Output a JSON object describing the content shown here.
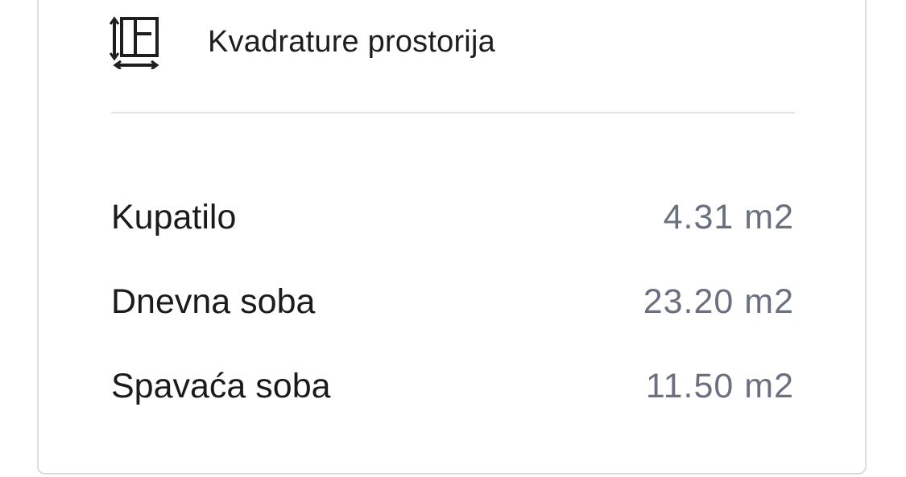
{
  "header": {
    "icon": "floor-plan-icon",
    "title": "Kvadrature prostorija"
  },
  "rooms": [
    {
      "name": "Kupatilo",
      "area": "4.31 m2"
    },
    {
      "name": "Dnevna soba",
      "area": "23.20 m2"
    },
    {
      "name": "Spavaća soba",
      "area": "11.50 m2"
    }
  ],
  "colors": {
    "text": "#1b1b1b",
    "value": "#6b7080",
    "border": "#dcdcdc",
    "divider": "#e3e3e3"
  }
}
